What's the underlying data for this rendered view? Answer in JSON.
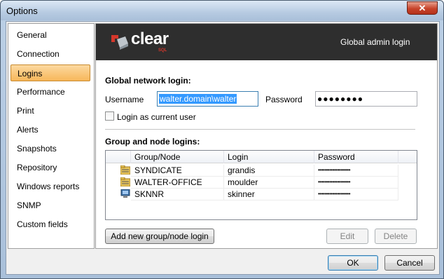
{
  "window": {
    "title": "Options",
    "close_glyph": "✕"
  },
  "nav": {
    "items": [
      {
        "label": "General"
      },
      {
        "label": "Connection"
      },
      {
        "label": "Logins",
        "active": true
      },
      {
        "label": "Performance"
      },
      {
        "label": "Print"
      },
      {
        "label": "Alerts"
      },
      {
        "label": "Snapshots"
      },
      {
        "label": "Repository"
      },
      {
        "label": "Windows reports"
      },
      {
        "label": "SNMP"
      },
      {
        "label": "Custom fields"
      }
    ]
  },
  "banner": {
    "logo_text": "clear",
    "logo_sub": "SQL",
    "title": "Global admin login",
    "background": "#2e2e2e",
    "accent": "#d4372b"
  },
  "global_login": {
    "heading": "Global network login:",
    "username_label": "Username",
    "username_value": "walter.domain\\walter",
    "password_label": "Password",
    "password_value": "●●●●●●●●",
    "login_as_current_user_label": "Login as current user",
    "login_as_current_user_checked": false
  },
  "group_logins": {
    "heading": "Group and node logins:",
    "columns": [
      "Group/Node",
      "Login",
      "Password"
    ],
    "rows": [
      {
        "icon": "group-folder-icon",
        "name": "SYNDICATE",
        "login": "grandis",
        "password": "••••••••••••••••••••"
      },
      {
        "icon": "group-folder-icon",
        "name": "WALTER-OFFICE",
        "login": "moulder",
        "password": "••••••••••••••••••••"
      },
      {
        "icon": "computer-node-icon",
        "name": "SKNNR",
        "login": "skinner",
        "password": "••••••••••••••••••••"
      }
    ]
  },
  "buttons": {
    "add_new": "Add new group/node login",
    "edit": "Edit",
    "delete": "Delete",
    "ok": "OK",
    "cancel": "Cancel"
  }
}
